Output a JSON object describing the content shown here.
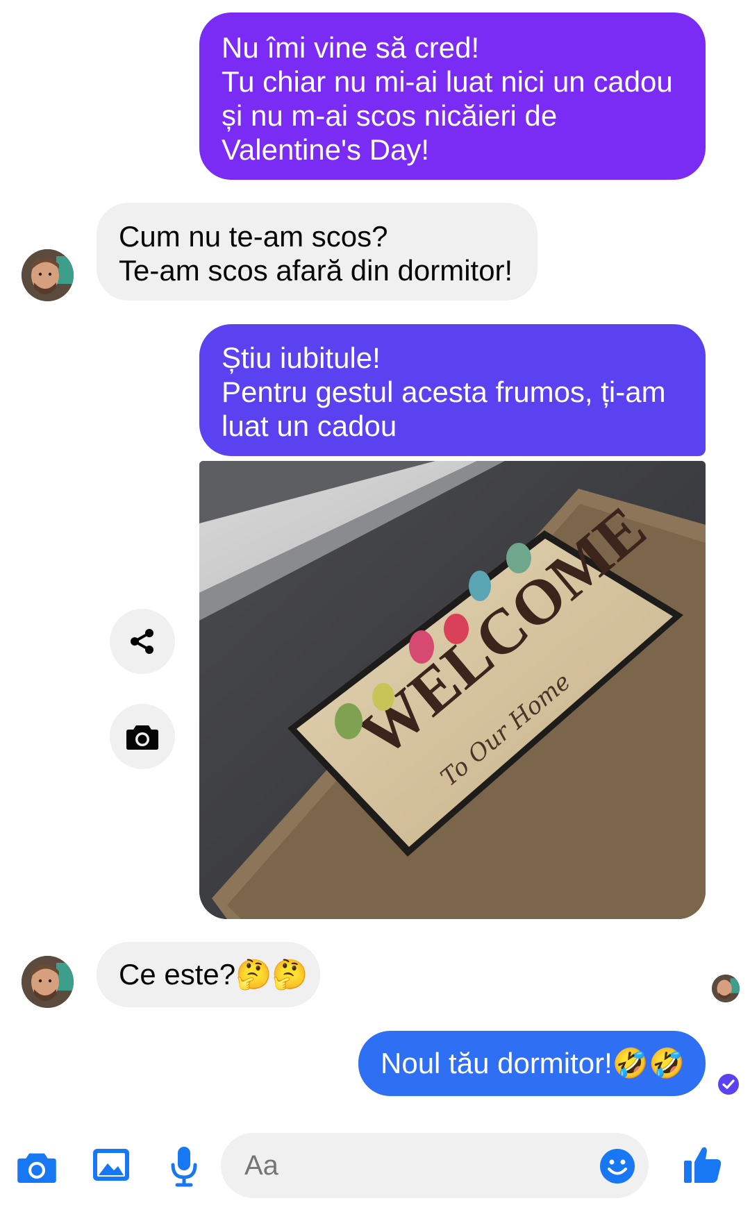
{
  "colors": {
    "sent_purple": "#7a2cf4",
    "sent_violet": "#5a42f0",
    "sent_blue": "#2f6ff3",
    "received_bg": "#f0f0f0",
    "accent": "#1877f2"
  },
  "messages": [
    {
      "direction": "sent",
      "text": "Nu îmi vine să cred!\nTu chiar nu mi-ai luat nici un cadou și nu m-ai scos nicăieri de Valentine's Day!"
    },
    {
      "direction": "received",
      "text": "Cum nu te-am scos?\nTe-am scos afară din dormitor!"
    },
    {
      "direction": "sent",
      "text": "Știu iubitule!\nPentru gestul acesta frumos, ți-am luat un cadou"
    },
    {
      "direction": "sent",
      "type": "photo"
    },
    {
      "direction": "received",
      "text": "Ce este?🤔🤔"
    },
    {
      "direction": "sent",
      "text": "Noul tău dormitor!🤣🤣"
    }
  ],
  "photo": {
    "mat_text_main": "WELCOME",
    "mat_text_script": "To Our Home"
  },
  "icons": {
    "share": "share-icon",
    "camera": "camera-icon",
    "gallery": "gallery-icon",
    "mic": "microphone-icon",
    "emoji": "emoji-icon",
    "like": "thumbs-up-icon",
    "delivered": "check-circle-icon"
  },
  "composer": {
    "placeholder": "Aa"
  }
}
